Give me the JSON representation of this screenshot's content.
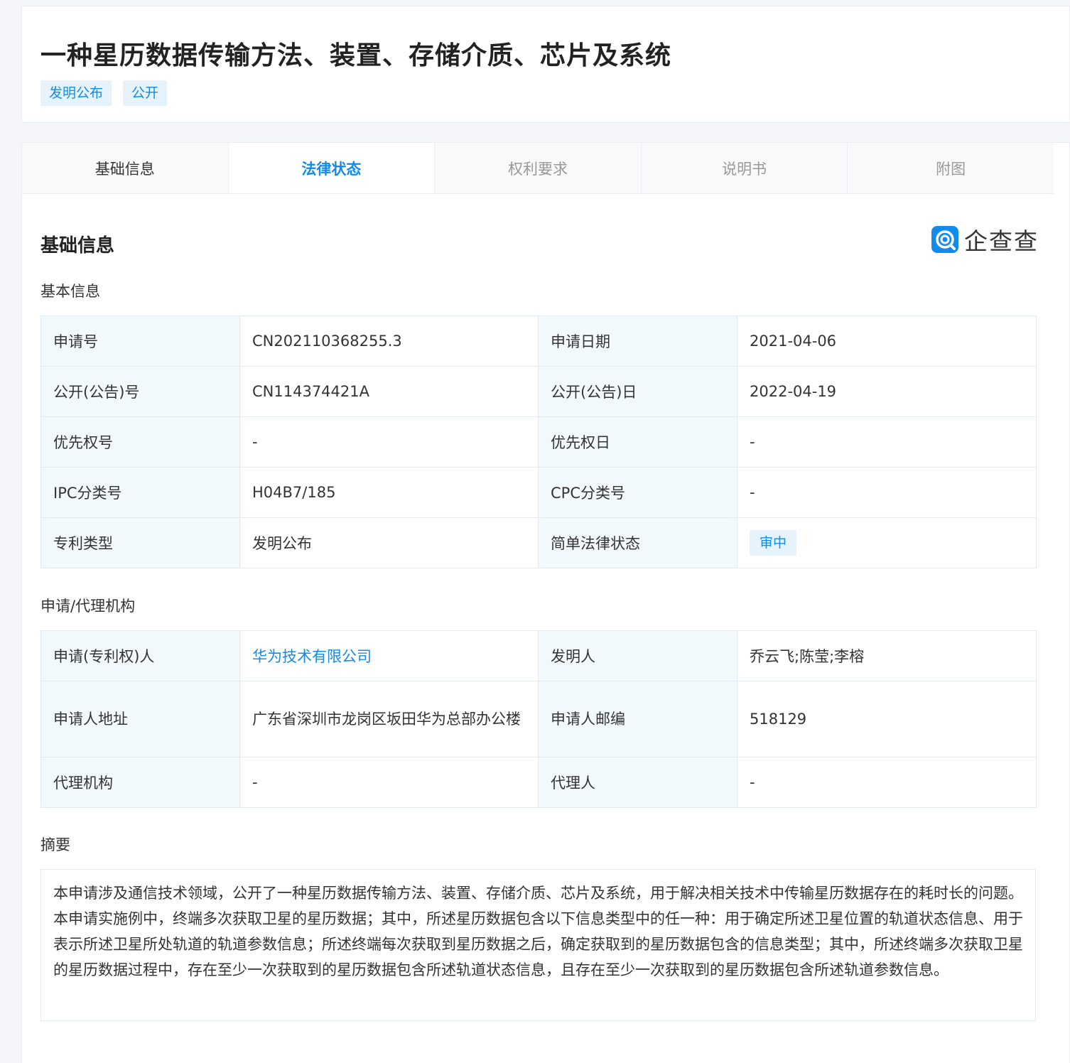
{
  "header": {
    "title": "一种星历数据传输方法、装置、存储介质、芯片及系统",
    "tags": [
      "发明公布",
      "公开"
    ]
  },
  "tabs": [
    "基础信息",
    "法律状态",
    "权利要求",
    "说明书",
    "附图"
  ],
  "active_tab": "法律状态",
  "section": {
    "title": "基础信息",
    "logo_text": "企查查"
  },
  "basic_info": {
    "heading": "基本信息",
    "rows": [
      {
        "l1": "申请号",
        "v1": "CN202110368255.3",
        "l2": "申请日期",
        "v2": "2021-04-06"
      },
      {
        "l1": "公开(公告)号",
        "v1": "CN114374421A",
        "l2": "公开(公告)日",
        "v2": "2022-04-19"
      },
      {
        "l1": "优先权号",
        "v1": "-",
        "l2": "优先权日",
        "v2": "-"
      },
      {
        "l1": "IPC分类号",
        "v1": "H04B7/185",
        "l2": "CPC分类号",
        "v2": "-"
      },
      {
        "l1": "专利类型",
        "v1": "发明公布",
        "l2": "简单法律状态",
        "v2": "审中"
      }
    ]
  },
  "applicant_info": {
    "heading": "申请/代理机构",
    "rows": [
      {
        "l1": "申请(专利权)人",
        "v1": "华为技术有限公司",
        "l2": "发明人",
        "v2": "乔云飞;陈莹;李榕"
      },
      {
        "l1": "申请人地址",
        "v1": "广东省深圳市龙岗区坂田华为总部办公楼",
        "l2": "申请人邮编",
        "v2": "518129"
      },
      {
        "l1": "代理机构",
        "v1": "-",
        "l2": "代理人",
        "v2": "-"
      }
    ]
  },
  "abstract": {
    "heading": "摘要",
    "text": "本申请涉及通信技术领域，公开了一种星历数据传输方法、装置、存储介质、芯片及系统，用于解决相关技术中传输星历数据存在的耗时长的问题。本申请实施例中，终端多次获取卫星的星历数据；其中，所述星历数据包含以下信息类型中的任一种：用于确定所述卫星位置的轨道状态信息、用于表示所述卫星所处轨道的轨道参数信息；所述终端每次获取到星历数据之后，确定获取到的星历数据包含的信息类型；其中，所述终端多次获取卫星的星历数据过程中，存在至少一次获取到的星历数据包含所述轨道状态信息，且存在至少一次获取到的星历数据包含所述轨道参数信息。"
  },
  "colors": {
    "accent": "#128bed",
    "label_bg": "#f2f9fd",
    "tag_bg": "#e6f3fc"
  }
}
